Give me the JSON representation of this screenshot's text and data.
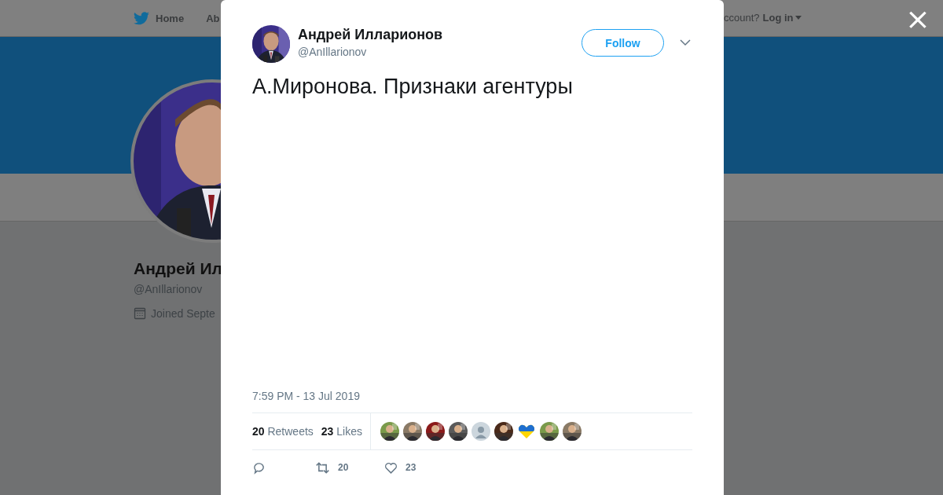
{
  "background_page": {
    "nav": {
      "items": [
        "Home",
        "Ab"
      ],
      "account_prompt": "ccount?",
      "login": "Log in"
    },
    "profile": {
      "avatar": {
        "kind": "picture"
      },
      "name": "Андрей Ил",
      "handle": "@AnIllarionov",
      "joined": "Joined Septe"
    }
  },
  "modal": {
    "close": "×",
    "tweet": {
      "author": {
        "name": "Андрей Илларионов",
        "handle": "@AnIllarionov",
        "avatar": {
          "kind": "picture"
        }
      },
      "follow_button": "Follow",
      "text": "А.Миронова. Признаки агентуры",
      "timestamp": "7:59 PM - 13 Jul 2019",
      "stats": [
        {
          "count": "20",
          "label": "Retweets"
        },
        {
          "count": "23",
          "label": "Likes"
        }
      ],
      "likers": [
        {
          "kind": "picture"
        },
        {
          "kind": "picture"
        },
        {
          "kind": "picture"
        },
        {
          "kind": "picture"
        },
        {
          "kind": "default"
        },
        {
          "kind": "picture"
        },
        {
          "kind": "heart"
        },
        {
          "kind": "picture"
        },
        {
          "kind": "picture"
        }
      ],
      "actions": [
        {
          "kind": "reply"
        },
        {
          "kind": "retweet",
          "count": "20"
        },
        {
          "kind": "like",
          "count": "23"
        }
      ]
    }
  }
}
